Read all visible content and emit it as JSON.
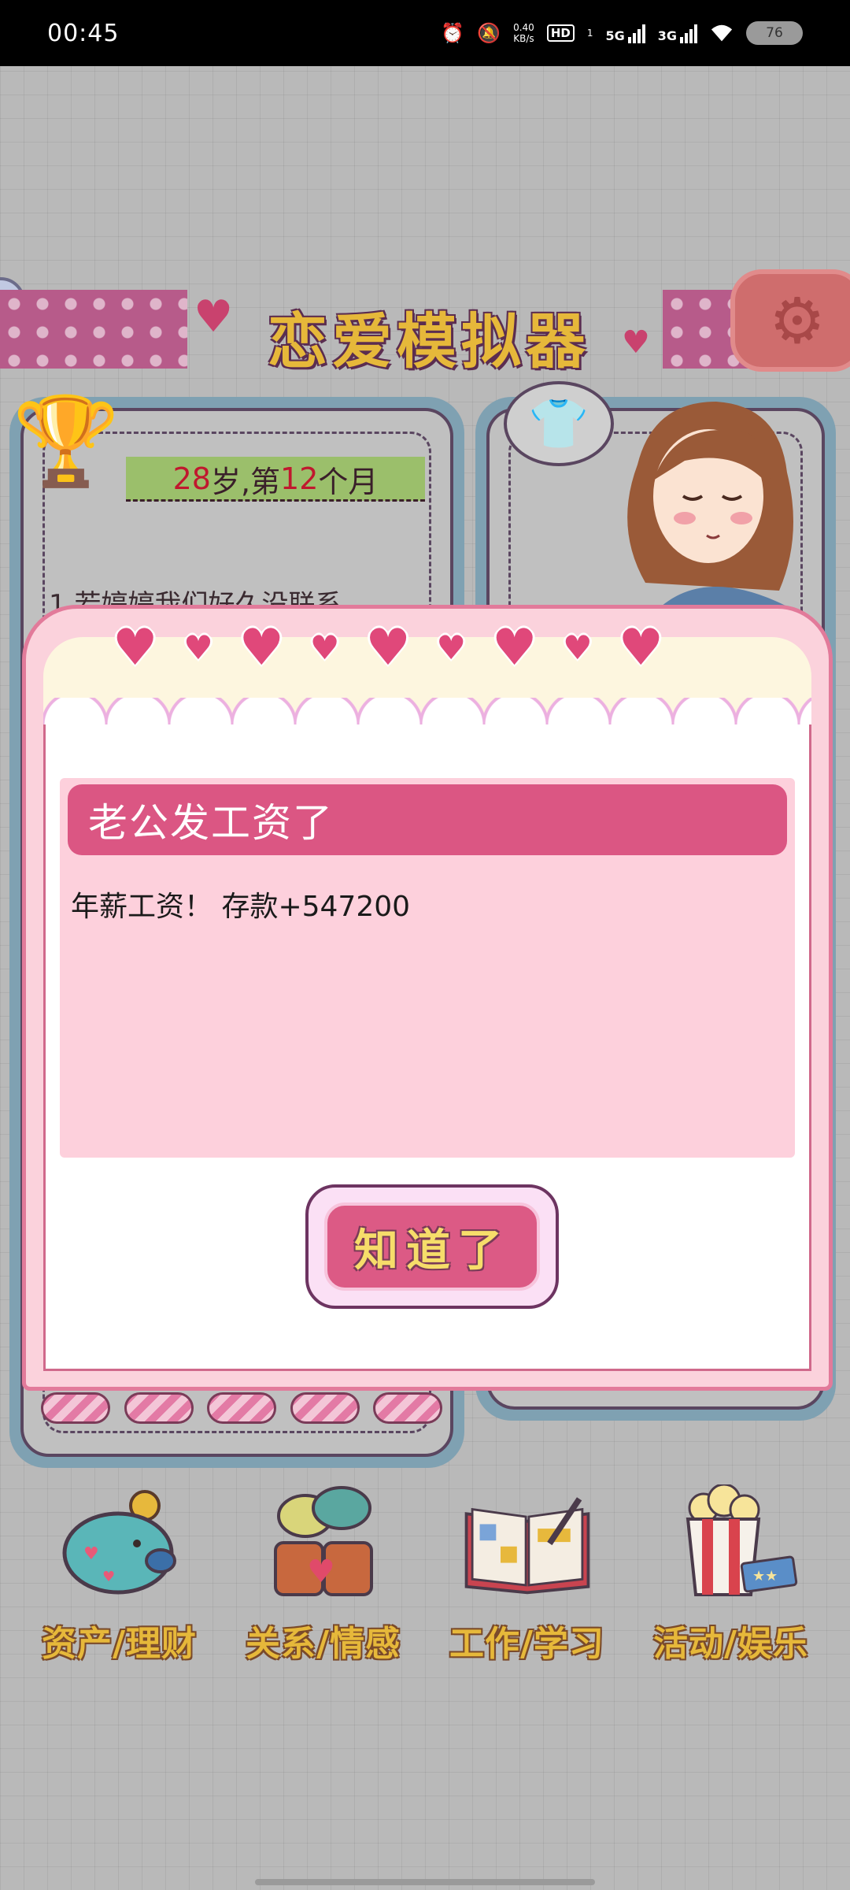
{
  "status_bar": {
    "time": "00:45",
    "net_speed_value": "0.40",
    "net_speed_unit": "KB/s",
    "hd_label": "HD",
    "hd_sub": "1",
    "network_1": "5G",
    "network_2": "3G",
    "battery": "76",
    "icons": [
      "alarm-icon",
      "mute-bell-icon",
      "wifi-icon",
      "battery-icon"
    ]
  },
  "header": {
    "title": "恋爱模拟器",
    "settings_icon": "gear-icon"
  },
  "left_panel": {
    "age_prefix": "28",
    "age_middle": "岁,第",
    "age_month": "12",
    "age_suffix": "个月",
    "event_text": "1.若婷婷我们好久没联系"
  },
  "dialog": {
    "title": "老公发工资了",
    "message": "年薪工资！ 存款+547200",
    "confirm_label": "知道了"
  },
  "menu": {
    "items": [
      {
        "label": "资产/理财",
        "icon": "piggy-bank-icon"
      },
      {
        "label": "关系/情感",
        "icon": "coffee-cups-icon"
      },
      {
        "label": "工作/学习",
        "icon": "open-book-icon"
      },
      {
        "label": "活动/娱乐",
        "icon": "popcorn-icon"
      }
    ]
  },
  "colors": {
    "accent_pink": "#db5683",
    "title_yellow": "#e6b83a",
    "dialog_bg": "#fbd2dc"
  }
}
